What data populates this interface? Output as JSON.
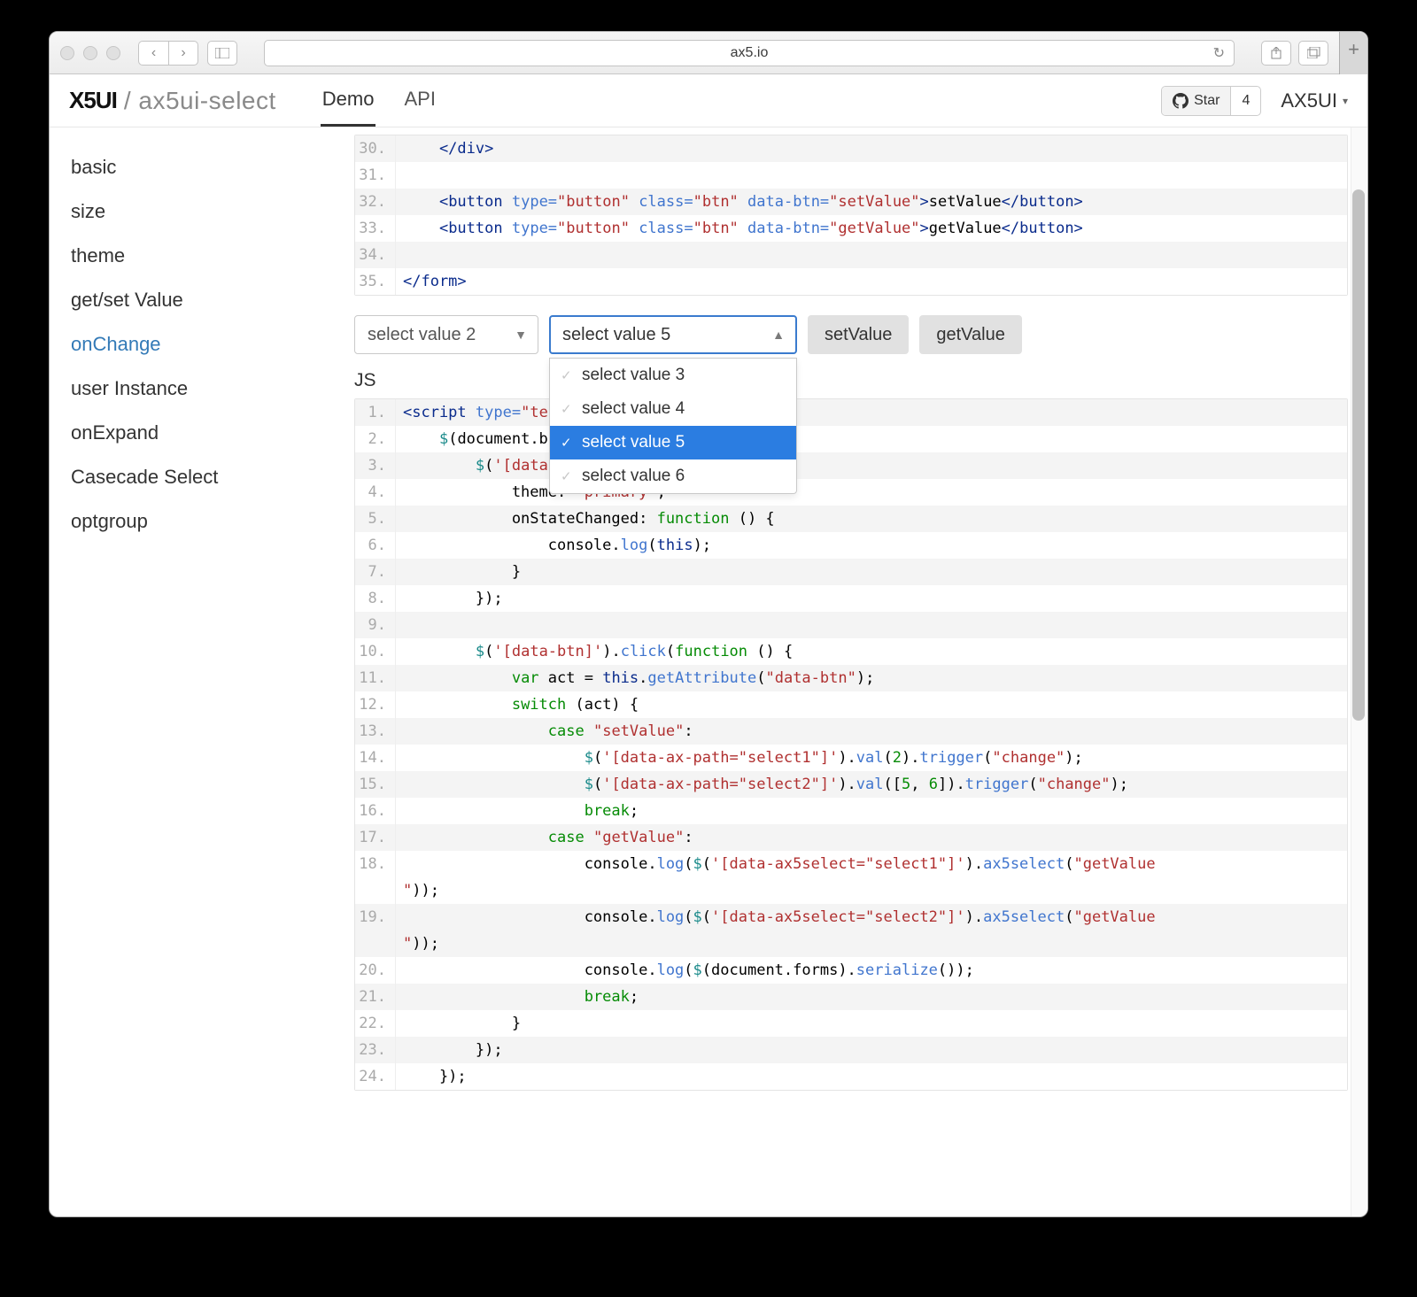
{
  "browser": {
    "url": "ax5.io"
  },
  "header": {
    "logo_mark": "X5UI",
    "logo_sub": "/ ax5ui-select",
    "tabs": [
      {
        "label": "Demo",
        "active": true
      },
      {
        "label": "API",
        "active": false
      }
    ],
    "github": {
      "label": "Star",
      "count": "4"
    },
    "brand": "AX5UI"
  },
  "sidebar": {
    "items": [
      {
        "label": "basic"
      },
      {
        "label": "size"
      },
      {
        "label": "theme"
      },
      {
        "label": "get/set Value"
      },
      {
        "label": "onChange",
        "active": true
      },
      {
        "label": "user Instance"
      },
      {
        "label": "onExpand"
      },
      {
        "label": "Casecade Select"
      },
      {
        "label": "optgroup"
      }
    ]
  },
  "code_top": [
    {
      "n": "30.",
      "html": "    </div>"
    },
    {
      "n": "31.",
      "html": ""
    },
    {
      "n": "32.",
      "html": "    <button type=\"button\" class=\"btn\" data-btn=\"setValue\">setValue</button>"
    },
    {
      "n": "33.",
      "html": "    <button type=\"button\" class=\"btn\" data-btn=\"getValue\">getValue</button>"
    },
    {
      "n": "34.",
      "html": ""
    },
    {
      "n": "35.",
      "html": "</form>"
    }
  ],
  "controls": {
    "select1": "select value 2",
    "select2": "select value 5",
    "btn_set": "setValue",
    "btn_get": "getValue",
    "dropdown": [
      {
        "label": "select value 3",
        "selected": false
      },
      {
        "label": "select value 4",
        "selected": false
      },
      {
        "label": "select value 5",
        "selected": true
      },
      {
        "label": "select value 6",
        "selected": false
      }
    ]
  },
  "js_label": "JS",
  "code_js_lines": [
    " 1.",
    " 2.",
    " 3.",
    " 4.",
    " 5.",
    " 6.",
    " 7.",
    " 8.",
    " 9.",
    "10.",
    "11.",
    "12.",
    "13.",
    "14.",
    "15.",
    "16.",
    "17.",
    "18.",
    "19.",
    "20.",
    "21.",
    "22.",
    "23.",
    "24."
  ]
}
